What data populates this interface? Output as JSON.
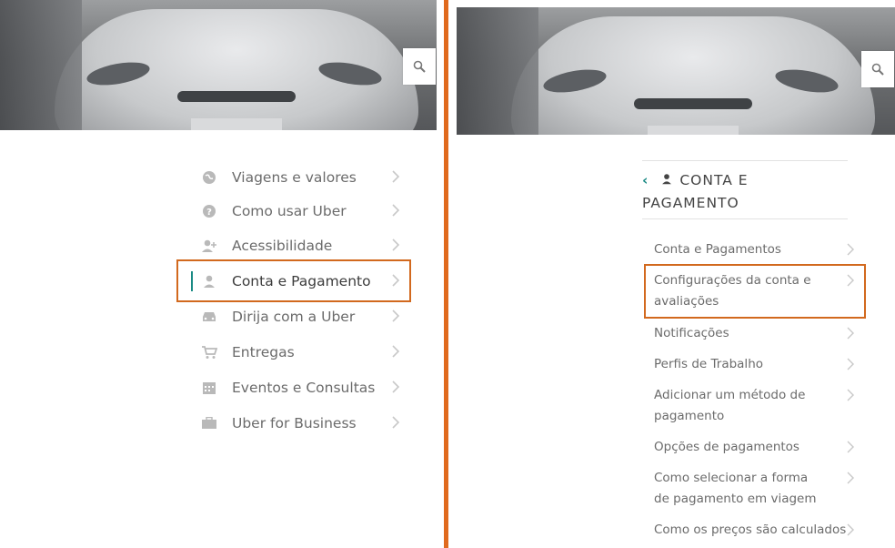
{
  "left": {
    "search_icon": "search-icon",
    "menu": [
      {
        "label": "Viagens e valores",
        "icon": "globe-icon"
      },
      {
        "label": "Como usar Uber",
        "icon": "help-icon"
      },
      {
        "label": "Acessibilidade",
        "icon": "person-add-icon"
      },
      {
        "label": "Conta e Pagamento",
        "icon": "person-icon",
        "active": true
      },
      {
        "label": "Dirija com a Uber",
        "icon": "car-icon"
      },
      {
        "label": "Entregas",
        "icon": "cart-icon"
      },
      {
        "label": "Eventos e Consultas",
        "icon": "calendar-icon"
      },
      {
        "label": "Uber for Business",
        "icon": "briefcase-icon"
      }
    ]
  },
  "right": {
    "search_icon": "search-icon",
    "section_title_line1": "CONTA E",
    "section_title_line2": "PAGAMENTO",
    "items": [
      {
        "label": "Conta e Pagamentos"
      },
      {
        "label": "Configurações da conta e avaliações",
        "highlighted": true
      },
      {
        "label": "Notificações"
      },
      {
        "label": "Perfis de Trabalho"
      },
      {
        "label": "Adicionar um método de pagamento"
      },
      {
        "label": "Opções de pagamentos"
      },
      {
        "label": "Como selecionar a forma de pagamento em viagem"
      },
      {
        "label": "Como os preços são calculados"
      }
    ]
  },
  "colors": {
    "highlight": "#d2691e",
    "accent": "#1a8a84",
    "divider": "#e06a1e",
    "text": "#6b6b6b"
  }
}
